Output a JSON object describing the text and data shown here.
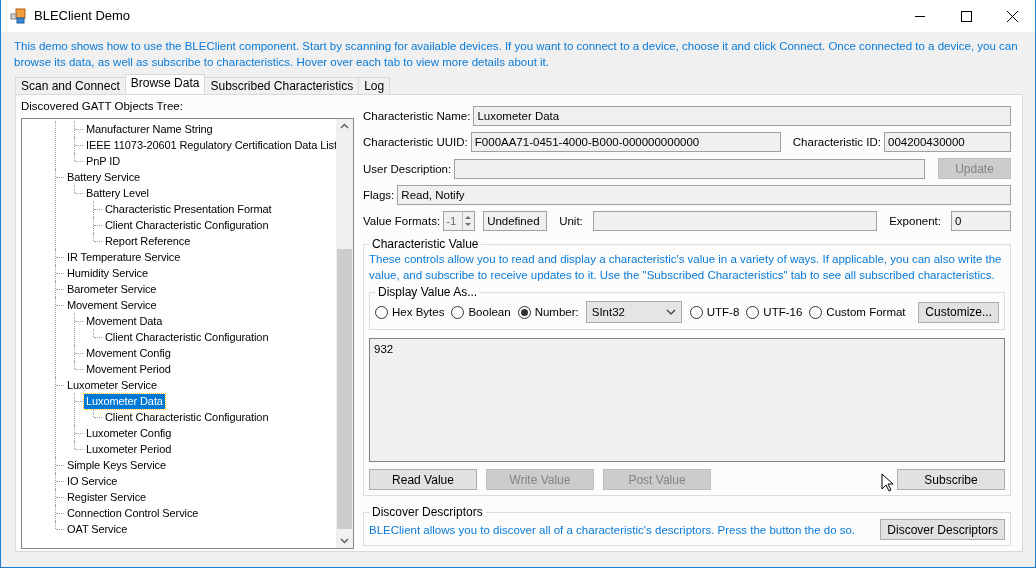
{
  "window": {
    "title": "BLEClient Demo"
  },
  "intro": "This demo shows how to use the BLEClient component. Start by scanning for available devices. If you want to connect to a device, choose it and click Connect. Once connected to a device, you can browse its data, as well as subscribe to characteristics. Hover over each tab to view more details about it.",
  "tabs": [
    {
      "label": "Scan and Connect",
      "selected": false
    },
    {
      "label": "Browse Data",
      "selected": true
    },
    {
      "label": "Subscribed Characteristics",
      "selected": false
    },
    {
      "label": "Log",
      "selected": false
    }
  ],
  "tree": {
    "title": "Discovered GATT Objects Tree:",
    "items": [
      {
        "children": [
          {
            "label": "Manufacturer Name String",
            "selected": false
          },
          {
            "label": "IEEE 11073-20601 Regulatory Certification Data List",
            "selected": false
          },
          {
            "label": "PnP ID",
            "selected": false
          }
        ]
      },
      {
        "label": "Battery Service",
        "selected": false,
        "children": [
          {
            "label": "Battery Level",
            "selected": false,
            "children": [
              {
                "label": "Characteristic Presentation Format",
                "selected": false
              },
              {
                "label": "Client Characteristic Configuration",
                "selected": false
              },
              {
                "label": "Report Reference",
                "selected": false
              }
            ]
          }
        ]
      },
      {
        "label": "IR Temperature Service",
        "selected": false
      },
      {
        "label": "Humidity Service",
        "selected": false
      },
      {
        "label": "Barometer Service",
        "selected": false
      },
      {
        "label": "Movement Service",
        "selected": false,
        "children": [
          {
            "label": "Movement Data",
            "selected": false,
            "children": [
              {
                "label": "Client Characteristic Configuration",
                "selected": false
              }
            ]
          },
          {
            "label": "Movement Config",
            "selected": false
          },
          {
            "label": "Movement Period",
            "selected": false
          }
        ]
      },
      {
        "label": "Luxometer Service",
        "selected": false,
        "children": [
          {
            "label": "Luxometer Data",
            "selected": true,
            "children": [
              {
                "label": "Client Characteristic Configuration",
                "selected": false
              }
            ]
          },
          {
            "label": "Luxometer Config",
            "selected": false
          },
          {
            "label": "Luxometer Period",
            "selected": false
          }
        ]
      },
      {
        "label": "Simple Keys Service",
        "selected": false
      },
      {
        "label": "IO Service",
        "selected": false
      },
      {
        "label": "Register Service",
        "selected": false
      },
      {
        "label": "Connection Control Service",
        "selected": false
      },
      {
        "label": "OAT Service",
        "selected": false
      }
    ]
  },
  "details": {
    "name_label": "Characteristic Name:",
    "name": "Luxometer Data",
    "uuid_label": "Characteristic UUID:",
    "uuid": "F000AA71-0451-4000-B000-000000000000",
    "id_label": "Characteristic ID:",
    "id": "004200430000",
    "description_label": "User Description:",
    "update_button": {
      "label": "Update",
      "disabled": true
    },
    "flags_label": "Flags:",
    "flags": "Read, Notify",
    "formats_label": "Value Formats:",
    "format_index": "-1",
    "format_name": "Undefined",
    "unit_label": "Unit:",
    "exponent_label": "Exponent:",
    "exponent": "0"
  },
  "value_group": {
    "title": "Characteristic Value",
    "help": "These controls allow you to read and display a characteristic's value in a variety of ways. If applicable, you can also write the value, and subscribe to receive updates to it. Use the \"Subscribed Characteristics\" tab to see all subscribed characteristics.",
    "display_title": "Display Value As...",
    "options": [
      {
        "kind": "radio",
        "label": "Hex Bytes",
        "selected": false
      },
      {
        "kind": "radio",
        "label": "Boolean",
        "selected": false
      },
      {
        "kind": "radio",
        "label": "Number:",
        "selected": true
      },
      {
        "kind": "dropdown",
        "value": "SInt32"
      },
      {
        "kind": "radio",
        "label": "UTF-8",
        "selected": false
      },
      {
        "kind": "radio",
        "label": "UTF-16",
        "selected": false
      },
      {
        "kind": "radio",
        "label": "Custom Format",
        "selected": false
      }
    ],
    "customize_button": "Customize...",
    "value": "932",
    "buttons": [
      {
        "label": "Read Value",
        "disabled": false
      },
      {
        "label": "Write Value",
        "disabled": true
      },
      {
        "label": "Post Value",
        "disabled": true
      },
      {
        "label": "Subscribe",
        "disabled": false
      }
    ]
  },
  "descriptors_group": {
    "title": "Discover Descriptors",
    "help": "BLEClient allows you to discover all of a characteristic's descriptors. Press the button the do so.",
    "button": "Discover Descriptors"
  }
}
